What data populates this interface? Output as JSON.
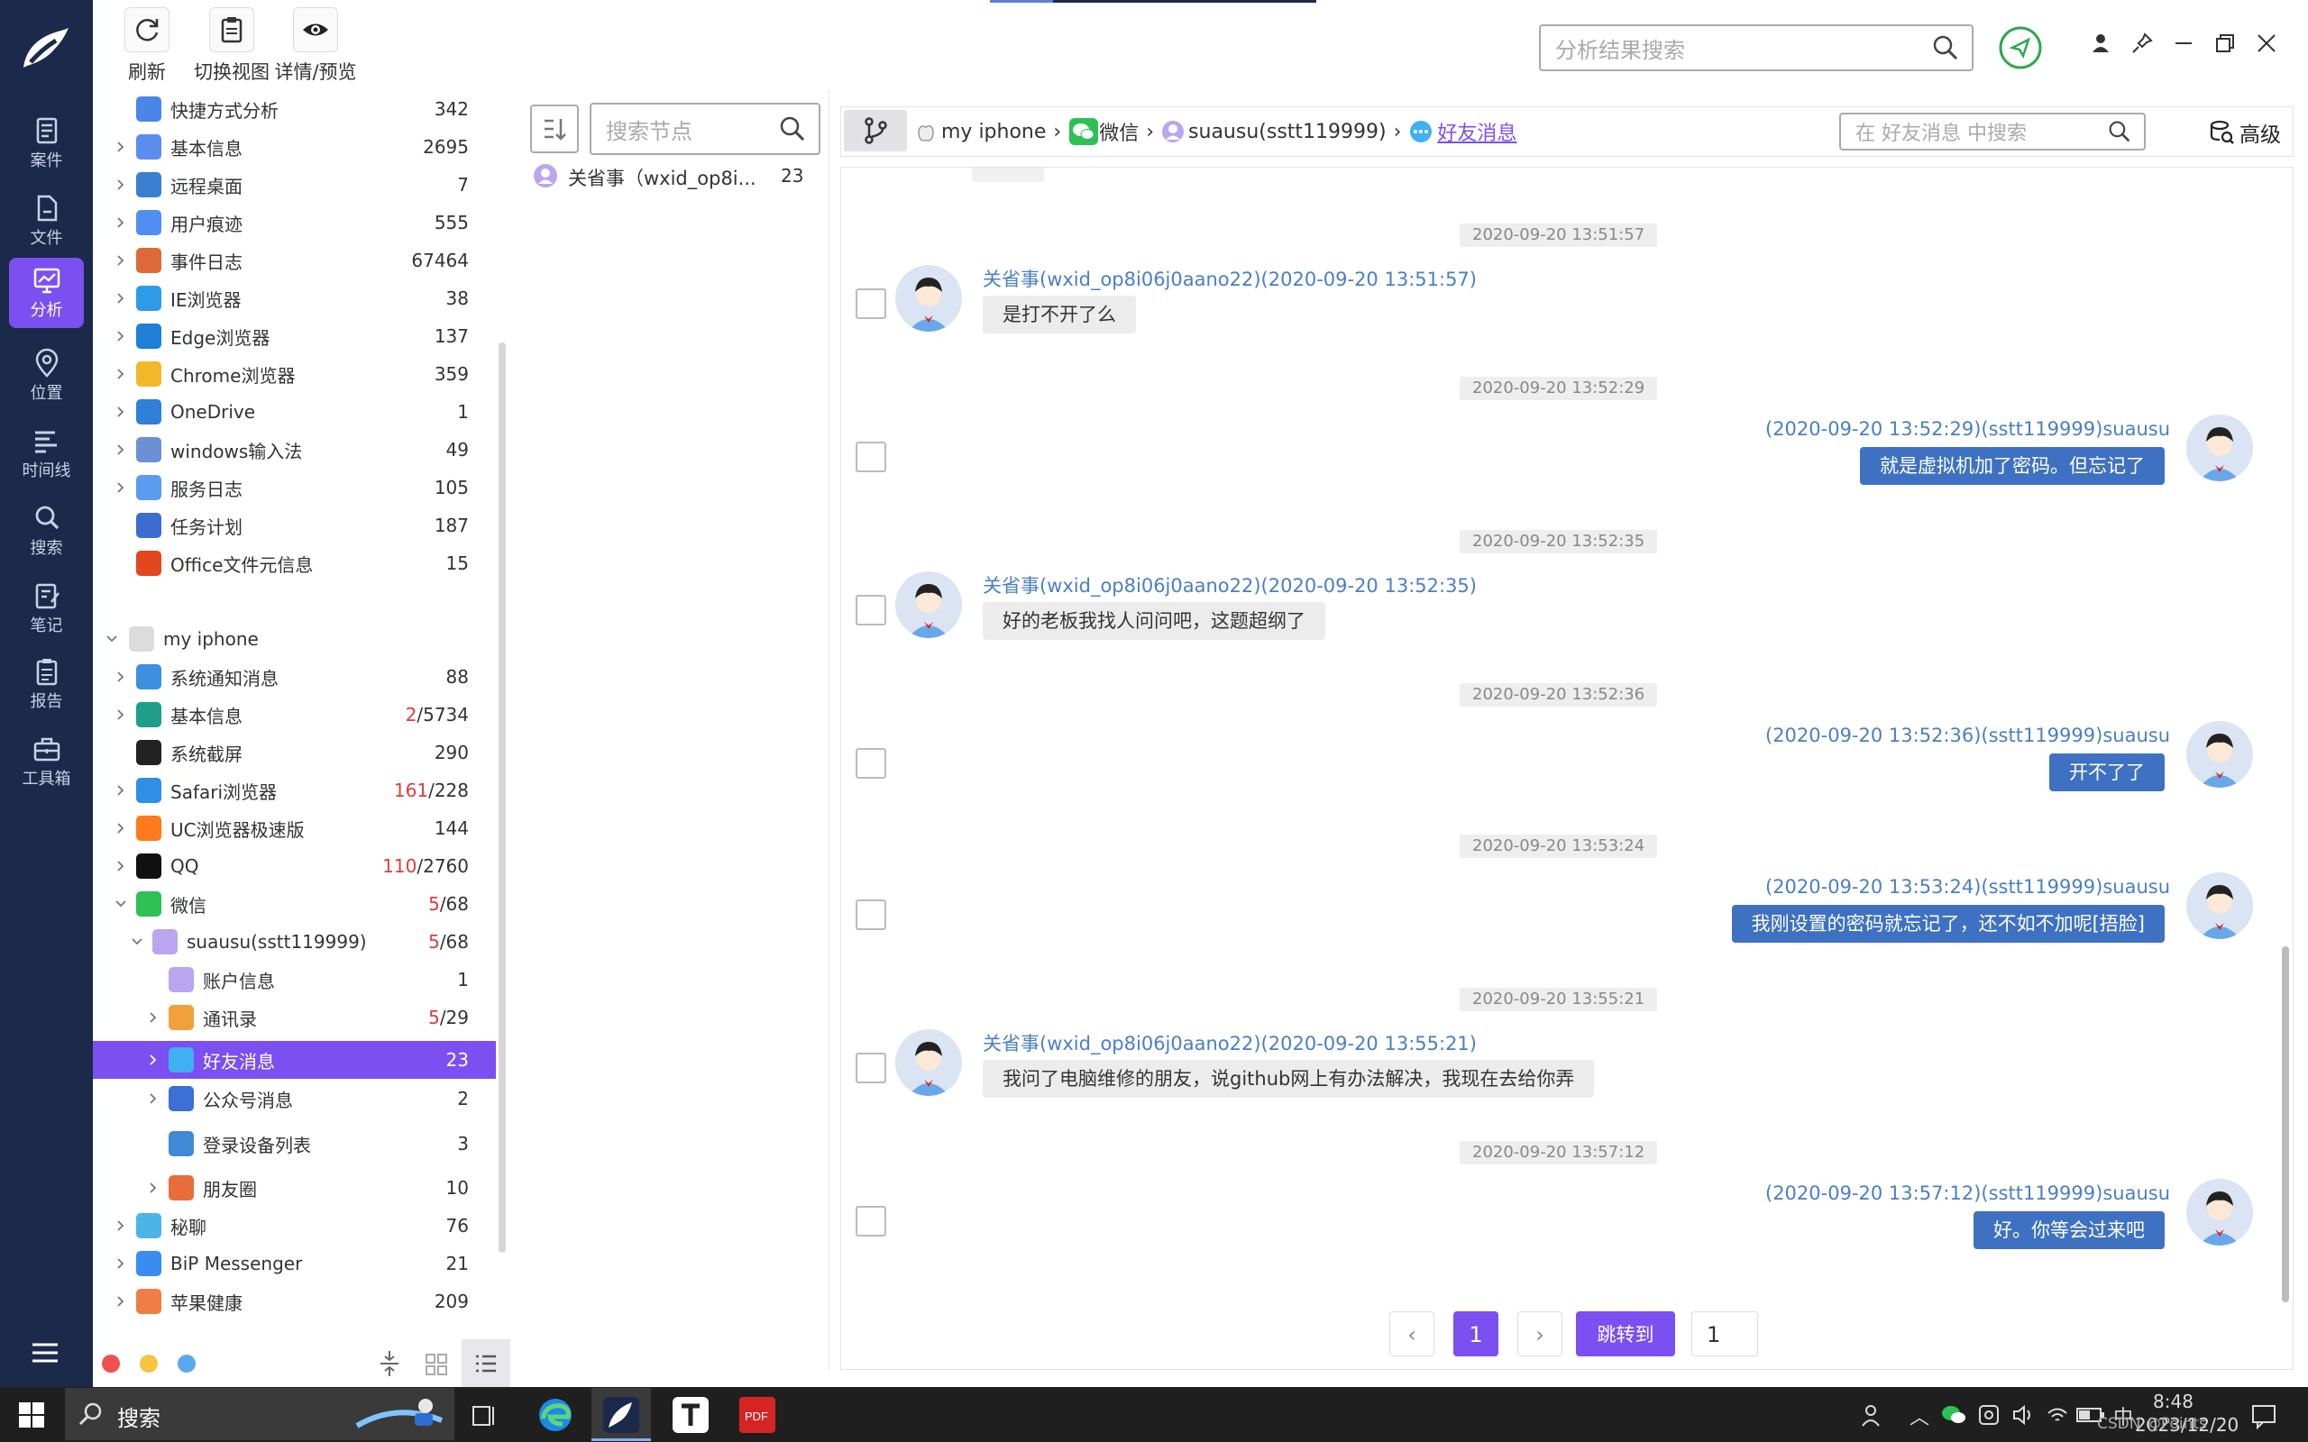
{
  "nav": {
    "items": [
      {
        "key": "case",
        "label": "案件"
      },
      {
        "key": "file",
        "label": "文件"
      },
      {
        "key": "analysis",
        "label": "分析"
      },
      {
        "key": "location",
        "label": "位置"
      },
      {
        "key": "timeline",
        "label": "时间线"
      },
      {
        "key": "search",
        "label": "搜索"
      },
      {
        "key": "notes",
        "label": "笔记"
      },
      {
        "key": "report",
        "label": "报告"
      },
      {
        "key": "toolbox",
        "label": "工具箱"
      }
    ],
    "active": "分析"
  },
  "toolbar": {
    "refresh": "刷新",
    "switch_view": "切换视图",
    "detail_preview": "详情/预览"
  },
  "top_search": {
    "placeholder": "分析结果搜索"
  },
  "tree": {
    "rows": [
      {
        "label": "快捷方式分析",
        "count": "342"
      },
      {
        "label": "基本信息",
        "count": "2695"
      },
      {
        "label": "远程桌面",
        "count": "7"
      },
      {
        "label": "用户痕迹",
        "count": "555"
      },
      {
        "label": "事件日志",
        "count": "67464"
      },
      {
        "label": "IE浏览器",
        "count": "38"
      },
      {
        "label": "Edge浏览器",
        "count": "137"
      },
      {
        "label": "Chrome浏览器",
        "count": "359"
      },
      {
        "label": "OneDrive",
        "count": "1"
      },
      {
        "label": "windows输入法",
        "count": "49"
      },
      {
        "label": "服务日志",
        "count": "105"
      },
      {
        "label": "任务计划",
        "count": "187"
      },
      {
        "label": "Office文件元信息",
        "count": "15"
      },
      {
        "label": "my iphone",
        "count": ""
      },
      {
        "label": "系统通知消息",
        "count": "88"
      },
      {
        "label": "基本信息",
        "count_red": "2",
        "count": "/5734"
      },
      {
        "label": "系统截屏",
        "count": "290"
      },
      {
        "label": "Safari浏览器",
        "count_red": "161",
        "count": "/228"
      },
      {
        "label": "UC浏览器极速版",
        "count": "144"
      },
      {
        "label": "QQ",
        "count_red": "110",
        "count": "/2760"
      },
      {
        "label": "微信",
        "count_red": "5",
        "count": "/68"
      },
      {
        "label": "suausu(sstt119999)",
        "count_red": "5",
        "count": "/68"
      },
      {
        "label": "账户信息",
        "count": "1"
      },
      {
        "label": "通讯录",
        "count_red": "5",
        "count": "/29"
      },
      {
        "label": "好友消息",
        "count": "23"
      },
      {
        "label": "公众号消息",
        "count": "2"
      },
      {
        "label": "登录设备列表",
        "count": "3"
      },
      {
        "label": "朋友圈",
        "count": "10"
      },
      {
        "label": "秘聊",
        "count": "76"
      },
      {
        "label": "BiP Messenger",
        "count": "21"
      },
      {
        "label": "苹果健康",
        "count": "209"
      }
    ]
  },
  "node_panel": {
    "search_placeholder": "搜索节点",
    "items": [
      {
        "label": "关省事（wxid_op8i...",
        "count": "23"
      }
    ]
  },
  "breadcrumb": {
    "items": [
      "my iphone",
      "微信",
      "suausu(sstt119999)",
      "好友消息"
    ]
  },
  "chat_search": {
    "placeholder": "在 好友消息 中搜索"
  },
  "advanced": "高级",
  "messages": [
    {
      "time": "2020-09-20 13:51:57",
      "dir": "in",
      "sender": "关省事(wxid_op8i06j0aano22)(2020-09-20 13:51:57)",
      "text": "是打不开了么"
    },
    {
      "time": "2020-09-20 13:52:29",
      "dir": "out",
      "sender": "(2020-09-20 13:52:29)(sstt119999)suausu",
      "text": "就是虚拟机加了密码。但忘记了"
    },
    {
      "time": "2020-09-20 13:52:35",
      "dir": "in",
      "sender": "关省事(wxid_op8i06j0aano22)(2020-09-20 13:52:35)",
      "text": "好的老板我找人问问吧，这题超纲了"
    },
    {
      "time": "2020-09-20 13:52:36",
      "dir": "out",
      "sender": "(2020-09-20 13:52:36)(sstt119999)suausu",
      "text": "开不了了"
    },
    {
      "time": "2020-09-20 13:53:24",
      "dir": "out",
      "sender": "(2020-09-20 13:53:24)(sstt119999)suausu",
      "text": "我刚设置的密码就忘记了，还不如不加呢[捂脸]"
    },
    {
      "time": "2020-09-20 13:55:21",
      "dir": "in",
      "sender": "关省事(wxid_op8i06j0aano22)(2020-09-20 13:55:21)",
      "text": "我问了电脑维修的朋友，说github网上有办法解决，我现在去给你弄"
    },
    {
      "time": "2020-09-20 13:57:12",
      "dir": "out",
      "sender": "(2020-09-20 13:57:12)(sstt119999)suausu",
      "text": "好。你等会过来吧"
    }
  ],
  "pagination": {
    "prev": "‹",
    "current": "1",
    "next": "›",
    "jump_label": "跳转到",
    "jump_value": "1"
  },
  "taskbar": {
    "search_label": "搜索",
    "ime": "中",
    "time": "8:48",
    "date": "2023/12/20",
    "watermark": "CSDN @Points"
  },
  "colors": {
    "nav_bg": "#1b2a4a",
    "accent": "#7b4ff0",
    "out_bubble": "#3e71c2",
    "link_blue": "#4a7fc4",
    "red_count": "#e23b3b"
  }
}
